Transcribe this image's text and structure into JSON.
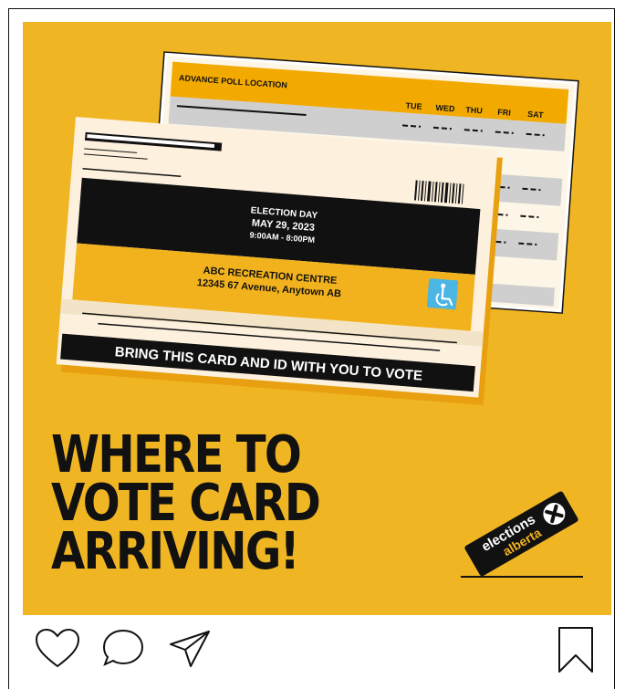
{
  "post": {
    "background_color": "#F0B523",
    "headline": [
      "WHERE TO",
      "VOTE CARD",
      "ARRIVING!"
    ]
  },
  "back_card": {
    "title": "ADVANCE POLL LOCATION",
    "days": [
      "TUE",
      "WED",
      "THU",
      "FRI",
      "SAT"
    ]
  },
  "front_card": {
    "election_label": "ELECTION DAY",
    "date": "MAY 29, 2023",
    "hours": "9:00AM - 8:00PM",
    "location_name": "ABC RECREATION CENTRE",
    "address": "12345 67 Avenue, Anytown AB",
    "footer": "BRING THIS CARD AND ID WITH YOU TO VOTE",
    "accessibility_icon": "wheelchair-icon"
  },
  "logo": {
    "line1": "elections",
    "line2": "alberta",
    "icon": "ballot-x-icon"
  },
  "actions": {
    "like": "heart-icon",
    "comment": "comment-icon",
    "share": "send-icon",
    "save": "bookmark-icon"
  }
}
